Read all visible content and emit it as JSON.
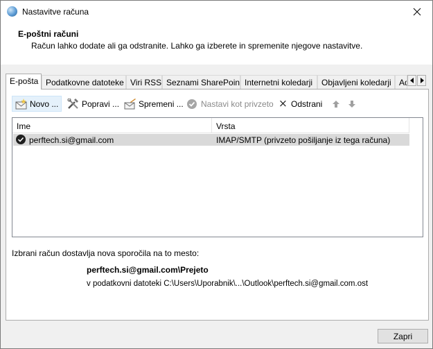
{
  "window": {
    "title": "Nastavitve računa"
  },
  "header": {
    "title": "E-poštni računi",
    "subtitle": "Račun lahko dodate ali ga odstranite. Lahko ga izberete in spremenite njegove nastavitve."
  },
  "tabs": [
    {
      "label": "E-pošta"
    },
    {
      "label": "Podatkovne datoteke"
    },
    {
      "label": "Viri RSS"
    },
    {
      "label": "Seznami SharePoint"
    },
    {
      "label": "Internetni koledarji"
    },
    {
      "label": "Objavljeni koledarji"
    },
    {
      "label": "Ad"
    }
  ],
  "toolbar": {
    "new_label": "Novo ...",
    "repair_label": "Popravi ...",
    "change_label": "Spremeni ...",
    "default_label": "Nastavi kot privzeto",
    "remove_label": "Odstrani"
  },
  "list": {
    "columns": [
      "Ime",
      "Vrsta"
    ],
    "rows": [
      {
        "name": "perftech.si@gmail.com",
        "type": "IMAP/SMTP (privzeto pošiljanje iz tega računa)"
      }
    ]
  },
  "delivery": {
    "label": "Izbrani račun dostavlja nova sporočila na to mesto:",
    "folder": "perftech.si@gmail.com\\Prejeto",
    "path": "v podatkovni datoteki C:\\Users\\Uporabnik\\...\\Outlook\\perftech.si@gmail.com.ost"
  },
  "footer": {
    "close_label": "Zapri"
  }
}
